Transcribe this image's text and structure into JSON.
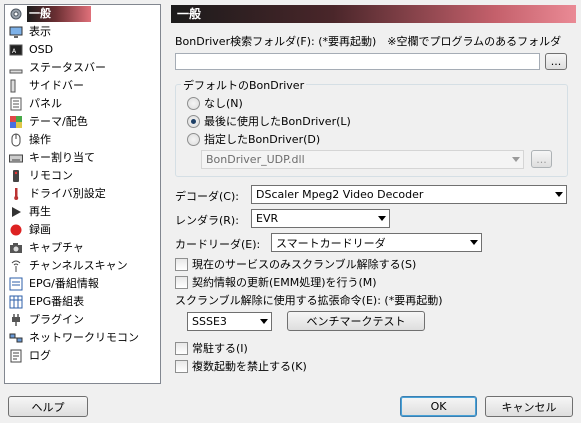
{
  "nav": {
    "items": [
      {
        "label": "一般",
        "icon": "gear-icon",
        "selected": true
      },
      {
        "label": "表示",
        "icon": "monitor-icon"
      },
      {
        "label": "OSD",
        "icon": "osd-icon"
      },
      {
        "label": "ステータスバー",
        "icon": "statusbar-icon"
      },
      {
        "label": "サイドバー",
        "icon": "sidebar-icon"
      },
      {
        "label": "パネル",
        "icon": "panel-icon"
      },
      {
        "label": "テーマ/配色",
        "icon": "palette-icon"
      },
      {
        "label": "操作",
        "icon": "mouse-icon"
      },
      {
        "label": "キー割り当て",
        "icon": "keyboard-icon"
      },
      {
        "label": "リモコン",
        "icon": "remote-icon"
      },
      {
        "label": "ドライバ別設定",
        "icon": "driver-icon"
      },
      {
        "label": "再生",
        "icon": "play-icon"
      },
      {
        "label": "録画",
        "icon": "record-icon"
      },
      {
        "label": "キャプチャ",
        "icon": "camera-icon"
      },
      {
        "label": "チャンネルスキャン",
        "icon": "antenna-icon"
      },
      {
        "label": "EPG/番組情報",
        "icon": "epg-info-icon"
      },
      {
        "label": "EPG番組表",
        "icon": "epg-table-icon"
      },
      {
        "label": "プラグイン",
        "icon": "plug-icon"
      },
      {
        "label": "ネットワークリモコン",
        "icon": "network-icon"
      },
      {
        "label": "ログ",
        "icon": "log-icon"
      }
    ]
  },
  "header": {
    "title": "一般"
  },
  "bondriver_folder": {
    "label": "BonDriver検索フォルダ(F): (*要再起動)　※空欄でプログラムのあるフォルダ",
    "value": "",
    "browse_label": "..."
  },
  "default_bondriver": {
    "title": "デフォルトのBonDriver",
    "options": [
      "なし(N)",
      "最後に使用したBonDriver(L)",
      "指定したBonDriver(D)"
    ],
    "selected_index": 1,
    "specified_value": "BonDriver_UDP.dll",
    "browse_label": "..."
  },
  "decoder": {
    "label": "デコーダ(C):",
    "value": "DScaler Mpeg2 Video Decoder"
  },
  "renderer": {
    "label": "レンダラ(R):",
    "value": "EVR"
  },
  "card_reader": {
    "label": "カードリーダ(E):",
    "value": "スマートカードリーダ"
  },
  "checks": {
    "descramble_current": "現在のサービスのみスクランブル解除する(S)",
    "emm_update": "契約情報の更新(EMM処理)を行う(M)"
  },
  "instruction_set": {
    "label": "スクランブル解除に使用する拡張命令(E): (*要再起動)",
    "value": "SSSE3",
    "benchmark_label": "ベンチマークテスト"
  },
  "checks2": {
    "resident": "常駐する(I)",
    "no_multiple": "複数起動を禁止する(K)"
  },
  "footer": {
    "help": "ヘルプ",
    "ok": "OK",
    "cancel": "キャンセル"
  }
}
